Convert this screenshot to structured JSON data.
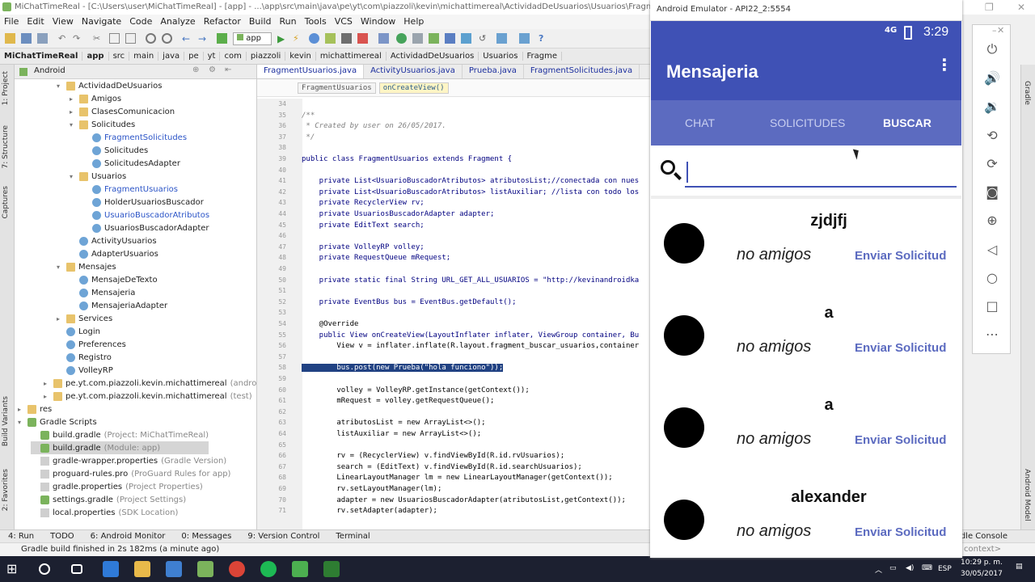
{
  "ide": {
    "window_title": "MiChatTimeReal - [C:\\Users\\user\\MiChatTimeReal] - [app] - ...\\app\\src\\main\\java\\pe\\yt\\com\\piazzoli\\kevin\\michattimereal\\ActividadDeUsuarios\\Usuarios\\FragmentUsuarios.java - Androi",
    "menu": [
      "File",
      "Edit",
      "View",
      "Navigate",
      "Code",
      "Analyze",
      "Refactor",
      "Build",
      "Run",
      "Tools",
      "VCS",
      "Window",
      "Help"
    ],
    "run_config": "app",
    "breadcrumb": [
      "MiChatTimeReal",
      "app",
      "src",
      "main",
      "java",
      "pe",
      "yt",
      "com",
      "piazzoli",
      "kevin",
      "michattimereal",
      "ActividadDeUsuarios",
      "Usuarios",
      "Fragme"
    ],
    "project_view": "Android",
    "left_tabs": [
      "1: Project",
      "7: Structure",
      "Captures",
      "Build Variants",
      "2: Favorites"
    ],
    "right_tabs": [
      "Gradle",
      "Android Model"
    ],
    "tree": [
      {
        "label": "ActividadDeUsuarios",
        "kind": "folder",
        "arrow": "▾"
      },
      {
        "label": "Amigos",
        "kind": "folder",
        "arrow": "▸"
      },
      {
        "label": "ClasesComunicacion",
        "kind": "folder",
        "arrow": "▸"
      },
      {
        "label": "Solicitudes",
        "kind": "folder",
        "arrow": "▾"
      },
      {
        "label": "FragmentSolicitudes",
        "kind": "class",
        "arrow": ""
      },
      {
        "label": "Solicitudes",
        "kind": "class",
        "arrow": ""
      },
      {
        "label": "SolicitudesAdapter",
        "kind": "class",
        "arrow": ""
      },
      {
        "label": "Usuarios",
        "kind": "folder",
        "arrow": "▾"
      },
      {
        "label": "FragmentUsuarios",
        "kind": "class",
        "arrow": ""
      },
      {
        "label": "HolderUsuariosBuscador",
        "kind": "class",
        "arrow": ""
      },
      {
        "label": "UsuarioBuscadorAtributos",
        "kind": "class",
        "arrow": ""
      },
      {
        "label": "UsuariosBuscadorAdapter",
        "kind": "class",
        "arrow": ""
      },
      {
        "label": "ActivityUsuarios",
        "kind": "class",
        "arrow": ""
      },
      {
        "label": "AdapterUsuarios",
        "kind": "class",
        "arrow": ""
      },
      {
        "label": "Mensajes",
        "kind": "folder",
        "arrow": "▾"
      },
      {
        "label": "MensajeDeTexto",
        "kind": "class",
        "arrow": ""
      },
      {
        "label": "Mensajeria",
        "kind": "class",
        "arrow": ""
      },
      {
        "label": "MensajeriaAdapter",
        "kind": "class",
        "arrow": ""
      },
      {
        "label": "Services",
        "kind": "folder",
        "arrow": "▸"
      },
      {
        "label": "Login",
        "kind": "class",
        "arrow": ""
      },
      {
        "label": "Preferences",
        "kind": "class",
        "arrow": ""
      },
      {
        "label": "Registro",
        "kind": "class",
        "arrow": ""
      },
      {
        "label": "VolleyRP",
        "kind": "class",
        "arrow": ""
      },
      {
        "label": "pe.yt.com.piazzoli.kevin.michattimereal",
        "sub": "(androidTest)",
        "kind": "folder",
        "arrow": "▸"
      },
      {
        "label": "pe.yt.com.piazzoli.kevin.michattimereal",
        "sub": "(test)",
        "kind": "folder",
        "arrow": "▸"
      },
      {
        "label": "res",
        "kind": "folder",
        "arrow": "▸"
      },
      {
        "label": "Gradle Scripts",
        "kind": "gradle",
        "arrow": "▾"
      },
      {
        "label": "build.gradle",
        "sub": "(Project: MiChatTimeReal)",
        "kind": "gradle",
        "arrow": ""
      },
      {
        "label": "build.gradle",
        "sub": "(Module: app)",
        "kind": "gradle",
        "arrow": ""
      },
      {
        "label": "gradle-wrapper.properties",
        "sub": "(Gradle Version)",
        "kind": "file",
        "arrow": ""
      },
      {
        "label": "proguard-rules.pro",
        "sub": "(ProGuard Rules for app)",
        "kind": "file",
        "arrow": ""
      },
      {
        "label": "gradle.properties",
        "sub": "(Project Properties)",
        "kind": "file",
        "arrow": ""
      },
      {
        "label": "settings.gradle",
        "sub": "(Project Settings)",
        "kind": "gradle",
        "arrow": ""
      },
      {
        "label": "local.properties",
        "sub": "(SDK Location)",
        "kind": "file",
        "arrow": ""
      }
    ],
    "editor_tabs": [
      "FragmentUsuarios.java",
      "ActivityUsuarios.java",
      "Prueba.java",
      "FragmentSolicitudes.java"
    ],
    "code_crumbs": [
      "FragmentUsuarios",
      "onCreateView()"
    ],
    "code_lines": [
      {
        "n": "34",
        "t": ""
      },
      {
        "n": "35",
        "t": "/**"
      },
      {
        "n": "36",
        "t": " * Created by user on 26/05/2017."
      },
      {
        "n": "37",
        "t": " */"
      },
      {
        "n": "38",
        "t": ""
      },
      {
        "n": "39",
        "t": "public class FragmentUsuarios extends Fragment {"
      },
      {
        "n": "40",
        "t": ""
      },
      {
        "n": "41",
        "t": "    private List<UsuarioBuscadorAtributos> atributosList;//conectada con nues"
      },
      {
        "n": "42",
        "t": "    private List<UsuarioBuscadorAtributos> listAuxiliar; //lista con todo los"
      },
      {
        "n": "43",
        "t": "    private RecyclerView rv;"
      },
      {
        "n": "44",
        "t": "    private UsuariosBuscadorAdapter adapter;"
      },
      {
        "n": "45",
        "t": "    private EditText search;"
      },
      {
        "n": "46",
        "t": ""
      },
      {
        "n": "47",
        "t": "    private VolleyRP volley;"
      },
      {
        "n": "48",
        "t": "    private RequestQueue mRequest;"
      },
      {
        "n": "49",
        "t": ""
      },
      {
        "n": "50",
        "t": "    private static final String URL_GET_ALL_USUARIOS = \"http://kevinandroidka"
      },
      {
        "n": "51",
        "t": ""
      },
      {
        "n": "52",
        "t": "    private EventBus bus = EventBus.getDefault();"
      },
      {
        "n": "53",
        "t": ""
      },
      {
        "n": "54",
        "t": "    @Override"
      },
      {
        "n": "55",
        "t": "    public View onCreateView(LayoutInflater inflater, ViewGroup container, Bu"
      },
      {
        "n": "56",
        "t": "        View v = inflater.inflate(R.layout.fragment_buscar_usuarios,container"
      },
      {
        "n": "57",
        "t": ""
      },
      {
        "n": "58",
        "t": "        bus.post(new Prueba(\"hola funciono\"));"
      },
      {
        "n": "59",
        "t": ""
      },
      {
        "n": "60",
        "t": "        volley = VolleyRP.getInstance(getContext());"
      },
      {
        "n": "61",
        "t": "        mRequest = volley.getRequestQueue();"
      },
      {
        "n": "62",
        "t": ""
      },
      {
        "n": "63",
        "t": "        atributosList = new ArrayList<>();"
      },
      {
        "n": "64",
        "t": "        listAuxiliar = new ArrayList<>();"
      },
      {
        "n": "65",
        "t": ""
      },
      {
        "n": "66",
        "t": "        rv = (RecyclerView) v.findViewById(R.id.rvUsuarios);"
      },
      {
        "n": "67",
        "t": "        search = (EditText) v.findViewById(R.id.searchUsuarios);"
      },
      {
        "n": "68",
        "t": "        LinearLayoutManager lm = new LinearLayoutManager(getContext());"
      },
      {
        "n": "69",
        "t": "        rv.setLayoutManager(lm);"
      },
      {
        "n": "70",
        "t": "        adapter = new UsuariosBuscadorAdapter(atributosList,getContext());"
      },
      {
        "n": "71",
        "t": "        rv.setAdapter(adapter);"
      }
    ],
    "bottom_tools": [
      "4: Run",
      "TODO",
      "6: Android Monitor",
      "0: Messages",
      "9: Version Control",
      "Terminal"
    ],
    "bottom_right_tool": "Gradle Console",
    "status_text": "Gradle build finished in 2s 182ms (a minute ago)",
    "status_context": "context>",
    "taskbar": {
      "lang": "ESP",
      "time": "10:29 p. m.",
      "date": "30/05/2017"
    }
  },
  "emulator": {
    "title": "Android Emulator - API22_2:5554",
    "signal": "4G",
    "clock": "3:29",
    "app_title": "Mensajeria",
    "tabs": [
      {
        "label": "CHAT",
        "active": false
      },
      {
        "label": "SOLICITUDES",
        "active": false
      },
      {
        "label": "BUSCAR",
        "active": true
      }
    ],
    "search": {
      "value": "",
      "placeholder": ""
    },
    "users": [
      {
        "name": "zjdjfj",
        "status": "no amigos",
        "action": "Enviar Solicitud"
      },
      {
        "name": "a",
        "status": "no amigos",
        "action": "Enviar Solicitud"
      },
      {
        "name": "a",
        "status": "no amigos",
        "action": "Enviar Solicitud"
      },
      {
        "name": "alexander",
        "status": "no amigos",
        "action": "Enviar Solicitud"
      }
    ],
    "accent": "#3f51b5",
    "tabbar_color": "#5c6bc0"
  }
}
